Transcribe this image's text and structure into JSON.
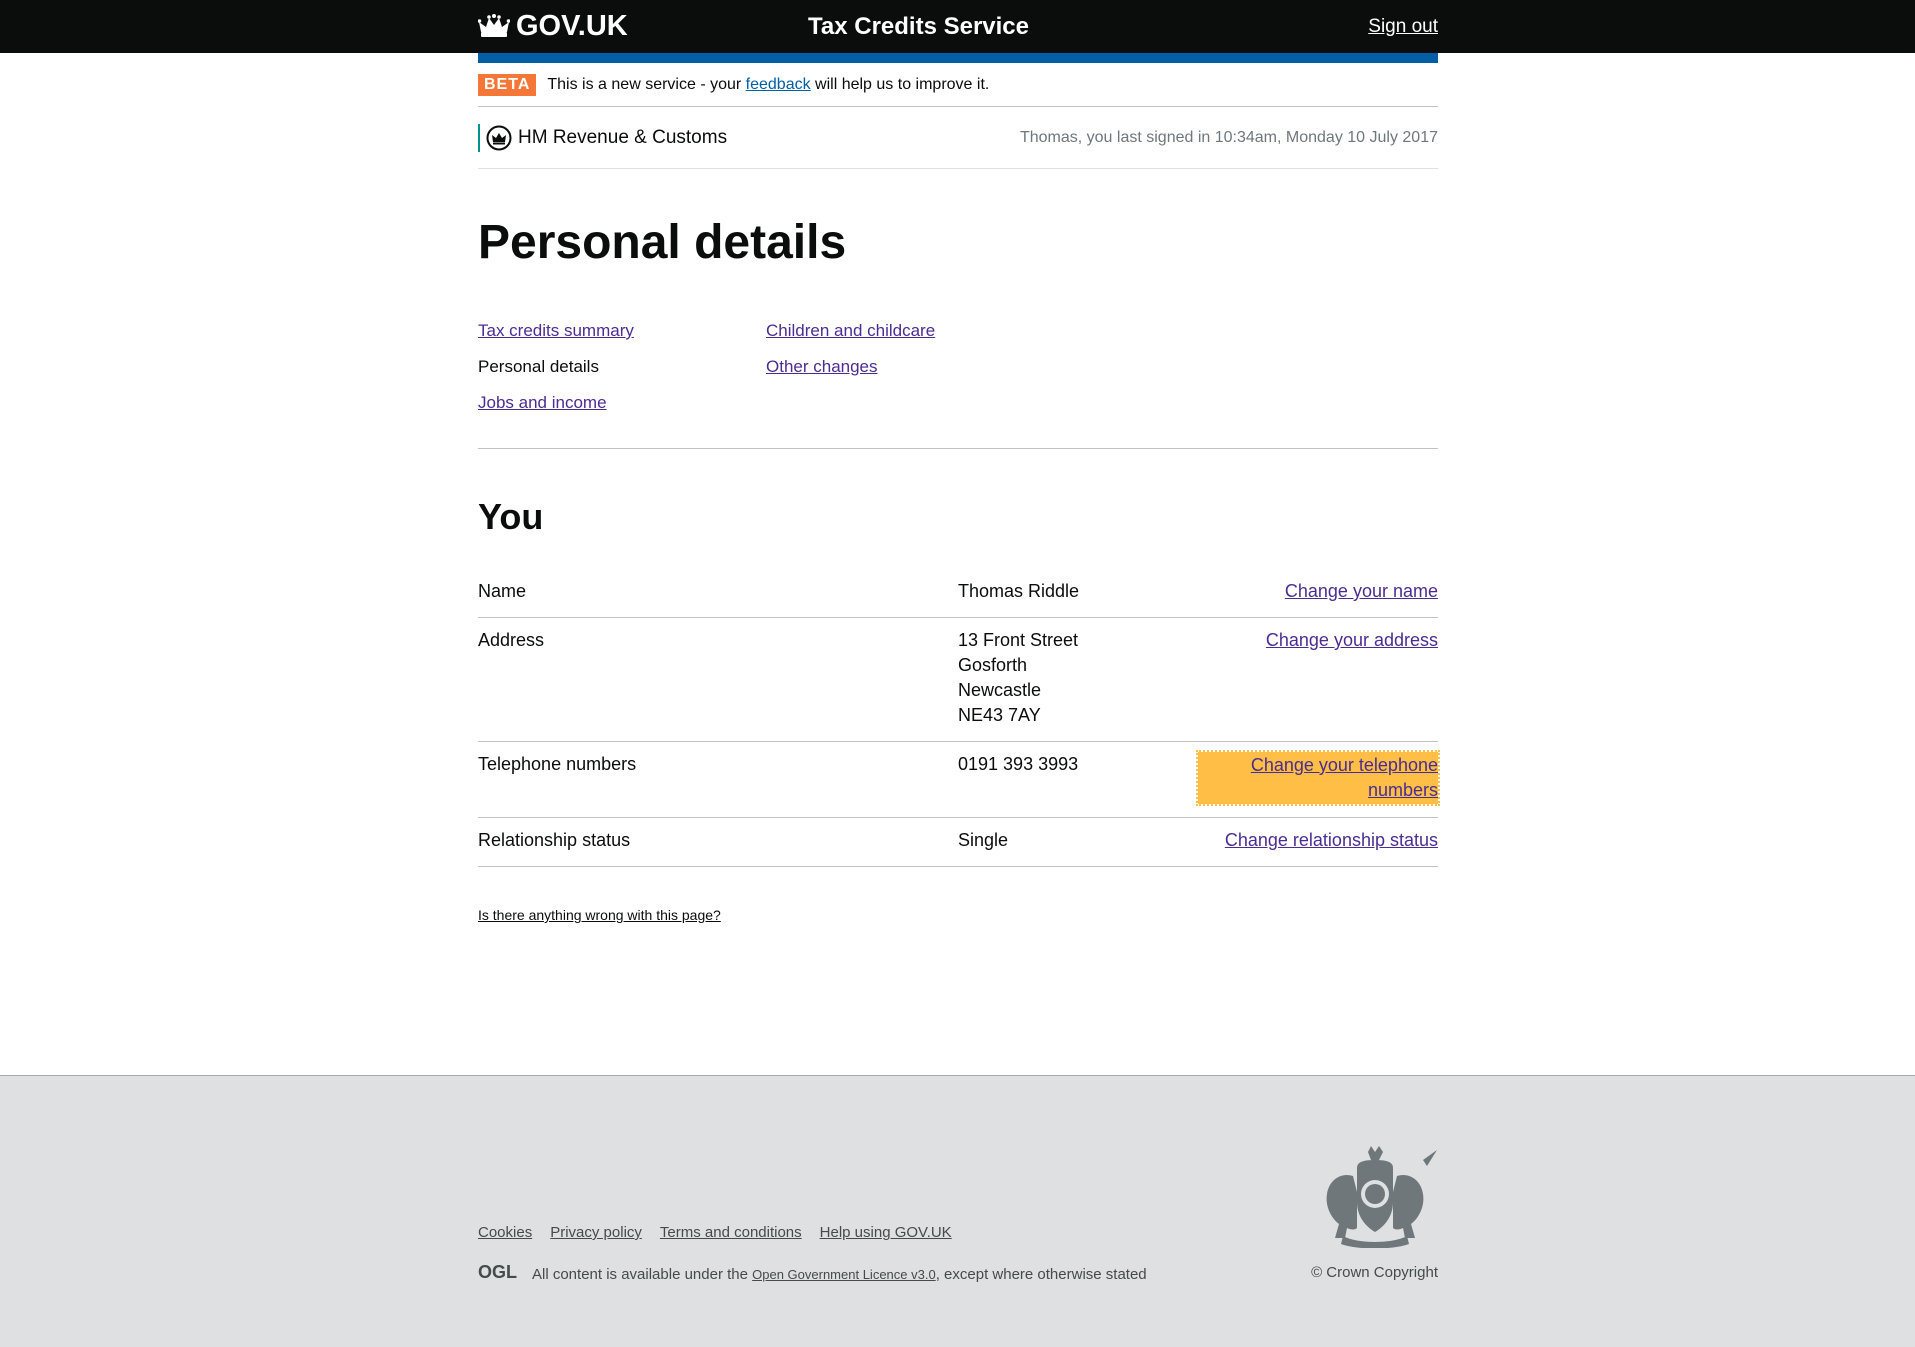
{
  "header": {
    "logo_text": "GOV.UK",
    "service_name": "Tax Credits Service",
    "sign_out": "Sign out"
  },
  "phase_banner": {
    "tag": "BETA",
    "text_before": "This is a new service - your ",
    "feedback_link": "feedback",
    "text_after": " will help us to improve it."
  },
  "org": {
    "name": "HM Revenue & Customs",
    "last_signed_in": "Thomas, you last signed in 10:34am, Monday 10 July 2017"
  },
  "page_title": "Personal details",
  "subnav": {
    "tax_credits_summary": "Tax credits summary",
    "personal_details": "Personal details",
    "jobs_and_income": "Jobs and income",
    "children_and_childcare": "Children and childcare",
    "other_changes": "Other changes"
  },
  "section_title": "You",
  "rows": {
    "name": {
      "key": "Name",
      "value": "Thomas Riddle",
      "action": "Change your name"
    },
    "address": {
      "key": "Address",
      "lines": [
        "13 Front Street",
        "Gosforth",
        "Newcastle",
        "NE43 7AY"
      ],
      "action": "Change your address"
    },
    "telephone": {
      "key": "Telephone numbers",
      "value": "0191 393 3993",
      "action": "Change your telephone numbers"
    },
    "relationship": {
      "key": "Relationship status",
      "value": "Single",
      "action": "Change relationship status"
    }
  },
  "report_problem": "Is there anything wrong with this page?",
  "footer": {
    "links": [
      "Cookies",
      "Privacy policy",
      "Terms and conditions",
      "Help using GOV.UK"
    ],
    "ogl_text_before": "All content is available under the ",
    "ogl_link": "Open Government Licence v3.0",
    "ogl_text_after": ", except where otherwise stated",
    "copyright": "© Crown Copyright",
    "ogl_logo": "OGL"
  },
  "colors": {
    "header_bg": "#0b0c0c",
    "blue_bar": "#005ea5",
    "beta_tag": "#f47738",
    "link": "#4c2c92",
    "focus": "#ffbf47",
    "footer_bg": "#dee0e2"
  }
}
